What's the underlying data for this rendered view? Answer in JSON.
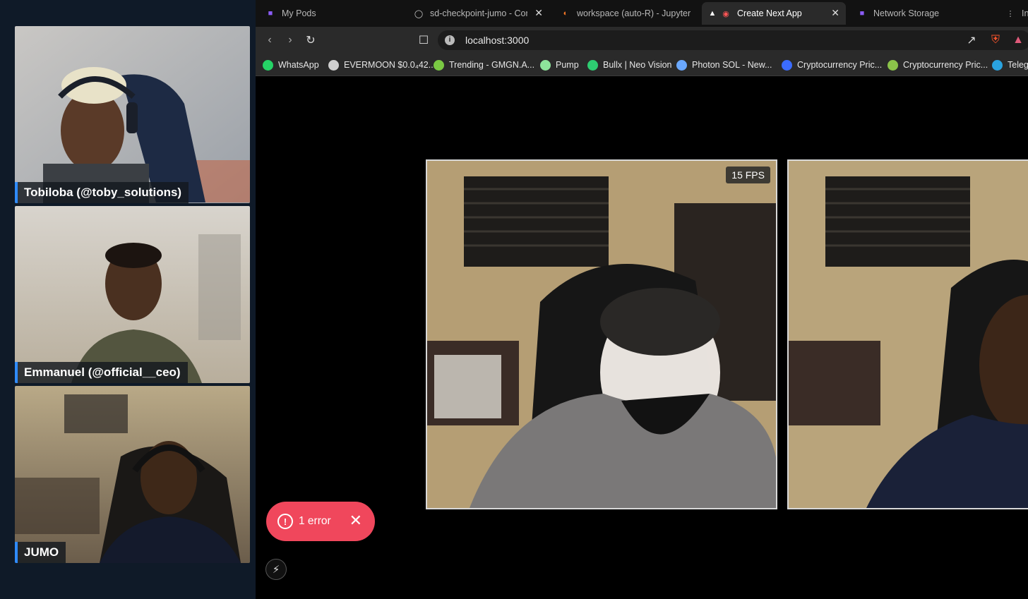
{
  "streams": [
    {
      "name": "Tobiloba (@toby_solutions)"
    },
    {
      "name": "Emmanuel (@official__ceo)"
    },
    {
      "name": "JUMO"
    }
  ],
  "tabs": [
    {
      "title": "My Pods",
      "icon": "pod-cube-icon"
    },
    {
      "title": "sd-checkpoint-jumo - Com",
      "icon": "globe-icon"
    },
    {
      "title": "workspace (auto-R) - JupyterLa",
      "icon": "jupyter-icon"
    },
    {
      "title": "Create Next App",
      "icon": "nextjs-icon",
      "active": true
    },
    {
      "title": "Network Storage",
      "icon": "pod-cube-icon"
    },
    {
      "title": "In",
      "icon": "grid-icon"
    }
  ],
  "address_bar": {
    "url": "localhost:3000"
  },
  "bookmarks": [
    {
      "label": "WhatsApp",
      "color": "#25d366"
    },
    {
      "label": "EVERMOON $0.0₄42...",
      "color": "#cfcfcf"
    },
    {
      "label": "Trending - GMGN.A...",
      "color": "#7ac943"
    },
    {
      "label": "Pump",
      "color": "#8ee59b"
    },
    {
      "label": "Bullx | Neo Vision",
      "color": "#2ecc71"
    },
    {
      "label": "Photon SOL - New...",
      "color": "#6aa8ff"
    },
    {
      "label": "Cryptocurrency Pric...",
      "color": "#3b6cff"
    },
    {
      "label": "Cryptocurrency Pric...",
      "color": "#8bc34a"
    },
    {
      "label": "Teleg",
      "color": "#2aa3e0"
    }
  ],
  "video": {
    "fps_label": "15 FPS"
  },
  "error_toast": {
    "label": "1 error",
    "icon": "!",
    "close": "✕"
  },
  "colors": {
    "accent_blue": "#2f8bff",
    "error_red": "#f0475c"
  }
}
